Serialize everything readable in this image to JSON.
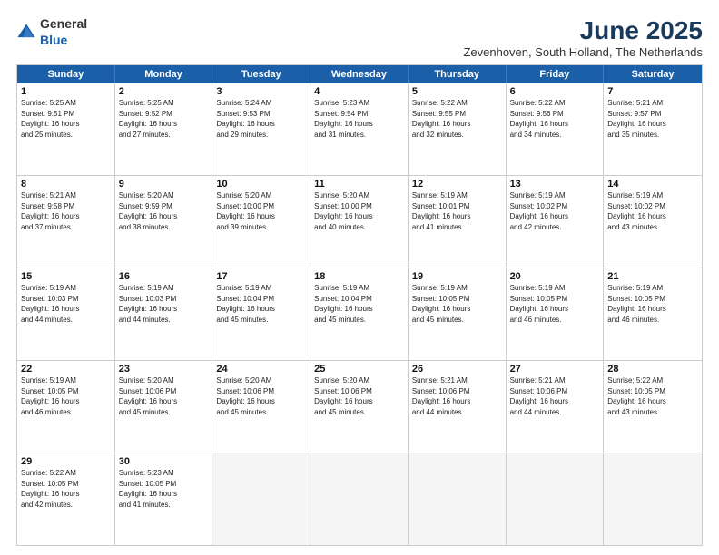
{
  "logo": {
    "general": "General",
    "blue": "Blue"
  },
  "title": "June 2025",
  "location": "Zevenhoven, South Holland, The Netherlands",
  "header_days": [
    "Sunday",
    "Monday",
    "Tuesday",
    "Wednesday",
    "Thursday",
    "Friday",
    "Saturday"
  ],
  "weeks": [
    [
      {
        "day": "1",
        "lines": [
          "Sunrise: 5:25 AM",
          "Sunset: 9:51 PM",
          "Daylight: 16 hours",
          "and 25 minutes."
        ]
      },
      {
        "day": "2",
        "lines": [
          "Sunrise: 5:25 AM",
          "Sunset: 9:52 PM",
          "Daylight: 16 hours",
          "and 27 minutes."
        ]
      },
      {
        "day": "3",
        "lines": [
          "Sunrise: 5:24 AM",
          "Sunset: 9:53 PM",
          "Daylight: 16 hours",
          "and 29 minutes."
        ]
      },
      {
        "day": "4",
        "lines": [
          "Sunrise: 5:23 AM",
          "Sunset: 9:54 PM",
          "Daylight: 16 hours",
          "and 31 minutes."
        ]
      },
      {
        "day": "5",
        "lines": [
          "Sunrise: 5:22 AM",
          "Sunset: 9:55 PM",
          "Daylight: 16 hours",
          "and 32 minutes."
        ]
      },
      {
        "day": "6",
        "lines": [
          "Sunrise: 5:22 AM",
          "Sunset: 9:56 PM",
          "Daylight: 16 hours",
          "and 34 minutes."
        ]
      },
      {
        "day": "7",
        "lines": [
          "Sunrise: 5:21 AM",
          "Sunset: 9:57 PM",
          "Daylight: 16 hours",
          "and 35 minutes."
        ]
      }
    ],
    [
      {
        "day": "8",
        "lines": [
          "Sunrise: 5:21 AM",
          "Sunset: 9:58 PM",
          "Daylight: 16 hours",
          "and 37 minutes."
        ]
      },
      {
        "day": "9",
        "lines": [
          "Sunrise: 5:20 AM",
          "Sunset: 9:59 PM",
          "Daylight: 16 hours",
          "and 38 minutes."
        ]
      },
      {
        "day": "10",
        "lines": [
          "Sunrise: 5:20 AM",
          "Sunset: 10:00 PM",
          "Daylight: 16 hours",
          "and 39 minutes."
        ]
      },
      {
        "day": "11",
        "lines": [
          "Sunrise: 5:20 AM",
          "Sunset: 10:00 PM",
          "Daylight: 16 hours",
          "and 40 minutes."
        ]
      },
      {
        "day": "12",
        "lines": [
          "Sunrise: 5:19 AM",
          "Sunset: 10:01 PM",
          "Daylight: 16 hours",
          "and 41 minutes."
        ]
      },
      {
        "day": "13",
        "lines": [
          "Sunrise: 5:19 AM",
          "Sunset: 10:02 PM",
          "Daylight: 16 hours",
          "and 42 minutes."
        ]
      },
      {
        "day": "14",
        "lines": [
          "Sunrise: 5:19 AM",
          "Sunset: 10:02 PM",
          "Daylight: 16 hours",
          "and 43 minutes."
        ]
      }
    ],
    [
      {
        "day": "15",
        "lines": [
          "Sunrise: 5:19 AM",
          "Sunset: 10:03 PM",
          "Daylight: 16 hours",
          "and 44 minutes."
        ]
      },
      {
        "day": "16",
        "lines": [
          "Sunrise: 5:19 AM",
          "Sunset: 10:03 PM",
          "Daylight: 16 hours",
          "and 44 minutes."
        ]
      },
      {
        "day": "17",
        "lines": [
          "Sunrise: 5:19 AM",
          "Sunset: 10:04 PM",
          "Daylight: 16 hours",
          "and 45 minutes."
        ]
      },
      {
        "day": "18",
        "lines": [
          "Sunrise: 5:19 AM",
          "Sunset: 10:04 PM",
          "Daylight: 16 hours",
          "and 45 minutes."
        ]
      },
      {
        "day": "19",
        "lines": [
          "Sunrise: 5:19 AM",
          "Sunset: 10:05 PM",
          "Daylight: 16 hours",
          "and 45 minutes."
        ]
      },
      {
        "day": "20",
        "lines": [
          "Sunrise: 5:19 AM",
          "Sunset: 10:05 PM",
          "Daylight: 16 hours",
          "and 46 minutes."
        ]
      },
      {
        "day": "21",
        "lines": [
          "Sunrise: 5:19 AM",
          "Sunset: 10:05 PM",
          "Daylight: 16 hours",
          "and 46 minutes."
        ]
      }
    ],
    [
      {
        "day": "22",
        "lines": [
          "Sunrise: 5:19 AM",
          "Sunset: 10:05 PM",
          "Daylight: 16 hours",
          "and 46 minutes."
        ]
      },
      {
        "day": "23",
        "lines": [
          "Sunrise: 5:20 AM",
          "Sunset: 10:06 PM",
          "Daylight: 16 hours",
          "and 45 minutes."
        ]
      },
      {
        "day": "24",
        "lines": [
          "Sunrise: 5:20 AM",
          "Sunset: 10:06 PM",
          "Daylight: 16 hours",
          "and 45 minutes."
        ]
      },
      {
        "day": "25",
        "lines": [
          "Sunrise: 5:20 AM",
          "Sunset: 10:06 PM",
          "Daylight: 16 hours",
          "and 45 minutes."
        ]
      },
      {
        "day": "26",
        "lines": [
          "Sunrise: 5:21 AM",
          "Sunset: 10:06 PM",
          "Daylight: 16 hours",
          "and 44 minutes."
        ]
      },
      {
        "day": "27",
        "lines": [
          "Sunrise: 5:21 AM",
          "Sunset: 10:06 PM",
          "Daylight: 16 hours",
          "and 44 minutes."
        ]
      },
      {
        "day": "28",
        "lines": [
          "Sunrise: 5:22 AM",
          "Sunset: 10:05 PM",
          "Daylight: 16 hours",
          "and 43 minutes."
        ]
      }
    ],
    [
      {
        "day": "29",
        "lines": [
          "Sunrise: 5:22 AM",
          "Sunset: 10:05 PM",
          "Daylight: 16 hours",
          "and 42 minutes."
        ]
      },
      {
        "day": "30",
        "lines": [
          "Sunrise: 5:23 AM",
          "Sunset: 10:05 PM",
          "Daylight: 16 hours",
          "and 41 minutes."
        ]
      },
      {
        "day": "",
        "lines": []
      },
      {
        "day": "",
        "lines": []
      },
      {
        "day": "",
        "lines": []
      },
      {
        "day": "",
        "lines": []
      },
      {
        "day": "",
        "lines": []
      }
    ]
  ]
}
